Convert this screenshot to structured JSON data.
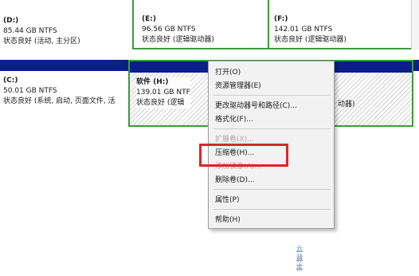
{
  "top_row": [
    {
      "letter": "(D:)",
      "size": "85.44 GB NTFS",
      "status": "状态良好 (活动, 主分区)"
    },
    {
      "letter": "(E:)",
      "size": "96.56 GB NTFS",
      "status": "状态良好 (逻辑驱动器)"
    },
    {
      "letter": "(F:)",
      "size": "142.01 GB NTFS",
      "status": "状态良好 (逻辑驱动器)"
    }
  ],
  "bottom_row": {
    "c": {
      "letter": "(C:)",
      "size": "50.01 GB NTFS",
      "status": "状态良好 (系统, 启动, 页面文件, 活"
    },
    "h": {
      "letter": "软件 (H:)",
      "size": "139.01 GB NTF",
      "status": "状态良好 (逻辑"
    },
    "next": {
      "status_tail": "动器)"
    }
  },
  "context_menu": {
    "items": [
      {
        "label": "打开(O)",
        "enabled": true
      },
      {
        "label": "资源管理器(E)",
        "enabled": true
      },
      {
        "label": "更改驱动器号和路径(C)...",
        "enabled": true
      },
      {
        "label": "格式化(F)...",
        "enabled": true
      },
      {
        "label": "扩展卷(X)...",
        "enabled": false
      },
      {
        "label": "压缩卷(H)...",
        "enabled": true
      },
      {
        "label": "添加镜像(A)...",
        "enabled": false
      },
      {
        "label": "删除卷(D)...",
        "enabled": true
      },
      {
        "label": "属性(P)",
        "enabled": true
      },
      {
        "label": "帮助(H)",
        "enabled": true
      }
    ]
  },
  "colors": {
    "volume_header": "#0b1e8a",
    "selection_border": "#3c9a3c",
    "highlight": "#d9262b"
  }
}
